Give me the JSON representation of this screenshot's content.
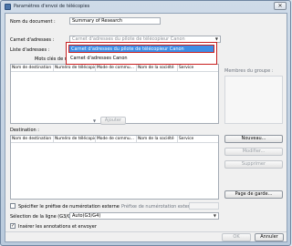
{
  "window": {
    "title": "Paramètres d'envoi de télécopies",
    "close_glyph": "✕"
  },
  "document_name": {
    "label": "Nom du document :",
    "value": "Summary of Research"
  },
  "address_book": {
    "label": "Carnet d'adresses :",
    "selected": "Carnet d'adresses du pilote de télécopieur Canon",
    "options": [
      "Carnet d'adresses du pilote de télécopieur Canon",
      "Carnet d'adresses Canon"
    ]
  },
  "address_list": {
    "label": "Liste d'adresses :",
    "search_label": "Mots clés de recherche :",
    "columns": [
      "Nom de destination",
      "Numéro de télécopie",
      "Mode de commu...",
      "Nom de la société",
      "Service"
    ]
  },
  "group_members_label": "Membres du groupe :",
  "add_button": "Ajouter",
  "add_arrow_glyph": "▼",
  "destination": {
    "label": "Destination :",
    "columns": [
      "Nom de destination",
      "Numéro de télécopie",
      "Mode de commu...",
      "Nom de la société",
      "Service"
    ]
  },
  "side_buttons": {
    "new": "Nouveau...",
    "modify": "Modifier...",
    "delete": "Supprimer"
  },
  "cover_page_button": "Page de garde...",
  "prefix": {
    "checkbox_label": "Spécifier le préfixe de numérotation externe",
    "checked": false,
    "prefix_label": "Préfixe de numérotation externe :"
  },
  "line": {
    "label": "Sélection de la ligne (G3/G4) :",
    "value": "Auto(G3/G4)"
  },
  "annotations": {
    "label": "Insérer les annotations et envoyer",
    "checked": true,
    "check_glyph": "✓"
  },
  "footer": {
    "ok": "OK",
    "cancel": "Annuler"
  },
  "colors": {
    "selection": "#3d8ee6",
    "highlight_border": "#c81e1e"
  }
}
